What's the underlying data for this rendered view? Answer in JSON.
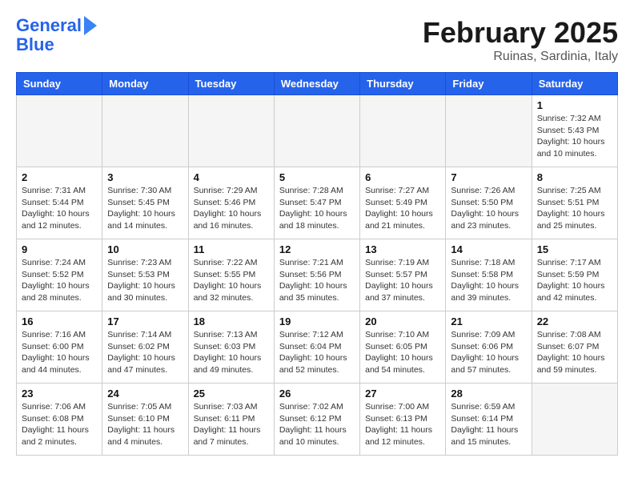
{
  "header": {
    "logo_line1": "General",
    "logo_line2": "Blue",
    "month_title": "February 2025",
    "location": "Ruinas, Sardinia, Italy"
  },
  "days_of_week": [
    "Sunday",
    "Monday",
    "Tuesday",
    "Wednesday",
    "Thursday",
    "Friday",
    "Saturday"
  ],
  "weeks": [
    [
      {
        "day": "",
        "info": ""
      },
      {
        "day": "",
        "info": ""
      },
      {
        "day": "",
        "info": ""
      },
      {
        "day": "",
        "info": ""
      },
      {
        "day": "",
        "info": ""
      },
      {
        "day": "",
        "info": ""
      },
      {
        "day": "1",
        "info": "Sunrise: 7:32 AM\nSunset: 5:43 PM\nDaylight: 10 hours and 10 minutes."
      }
    ],
    [
      {
        "day": "2",
        "info": "Sunrise: 7:31 AM\nSunset: 5:44 PM\nDaylight: 10 hours and 12 minutes."
      },
      {
        "day": "3",
        "info": "Sunrise: 7:30 AM\nSunset: 5:45 PM\nDaylight: 10 hours and 14 minutes."
      },
      {
        "day": "4",
        "info": "Sunrise: 7:29 AM\nSunset: 5:46 PM\nDaylight: 10 hours and 16 minutes."
      },
      {
        "day": "5",
        "info": "Sunrise: 7:28 AM\nSunset: 5:47 PM\nDaylight: 10 hours and 18 minutes."
      },
      {
        "day": "6",
        "info": "Sunrise: 7:27 AM\nSunset: 5:49 PM\nDaylight: 10 hours and 21 minutes."
      },
      {
        "day": "7",
        "info": "Sunrise: 7:26 AM\nSunset: 5:50 PM\nDaylight: 10 hours and 23 minutes."
      },
      {
        "day": "8",
        "info": "Sunrise: 7:25 AM\nSunset: 5:51 PM\nDaylight: 10 hours and 25 minutes."
      }
    ],
    [
      {
        "day": "9",
        "info": "Sunrise: 7:24 AM\nSunset: 5:52 PM\nDaylight: 10 hours and 28 minutes."
      },
      {
        "day": "10",
        "info": "Sunrise: 7:23 AM\nSunset: 5:53 PM\nDaylight: 10 hours and 30 minutes."
      },
      {
        "day": "11",
        "info": "Sunrise: 7:22 AM\nSunset: 5:55 PM\nDaylight: 10 hours and 32 minutes."
      },
      {
        "day": "12",
        "info": "Sunrise: 7:21 AM\nSunset: 5:56 PM\nDaylight: 10 hours and 35 minutes."
      },
      {
        "day": "13",
        "info": "Sunrise: 7:19 AM\nSunset: 5:57 PM\nDaylight: 10 hours and 37 minutes."
      },
      {
        "day": "14",
        "info": "Sunrise: 7:18 AM\nSunset: 5:58 PM\nDaylight: 10 hours and 39 minutes."
      },
      {
        "day": "15",
        "info": "Sunrise: 7:17 AM\nSunset: 5:59 PM\nDaylight: 10 hours and 42 minutes."
      }
    ],
    [
      {
        "day": "16",
        "info": "Sunrise: 7:16 AM\nSunset: 6:00 PM\nDaylight: 10 hours and 44 minutes."
      },
      {
        "day": "17",
        "info": "Sunrise: 7:14 AM\nSunset: 6:02 PM\nDaylight: 10 hours and 47 minutes."
      },
      {
        "day": "18",
        "info": "Sunrise: 7:13 AM\nSunset: 6:03 PM\nDaylight: 10 hours and 49 minutes."
      },
      {
        "day": "19",
        "info": "Sunrise: 7:12 AM\nSunset: 6:04 PM\nDaylight: 10 hours and 52 minutes."
      },
      {
        "day": "20",
        "info": "Sunrise: 7:10 AM\nSunset: 6:05 PM\nDaylight: 10 hours and 54 minutes."
      },
      {
        "day": "21",
        "info": "Sunrise: 7:09 AM\nSunset: 6:06 PM\nDaylight: 10 hours and 57 minutes."
      },
      {
        "day": "22",
        "info": "Sunrise: 7:08 AM\nSunset: 6:07 PM\nDaylight: 10 hours and 59 minutes."
      }
    ],
    [
      {
        "day": "23",
        "info": "Sunrise: 7:06 AM\nSunset: 6:08 PM\nDaylight: 11 hours and 2 minutes."
      },
      {
        "day": "24",
        "info": "Sunrise: 7:05 AM\nSunset: 6:10 PM\nDaylight: 11 hours and 4 minutes."
      },
      {
        "day": "25",
        "info": "Sunrise: 7:03 AM\nSunset: 6:11 PM\nDaylight: 11 hours and 7 minutes."
      },
      {
        "day": "26",
        "info": "Sunrise: 7:02 AM\nSunset: 6:12 PM\nDaylight: 11 hours and 10 minutes."
      },
      {
        "day": "27",
        "info": "Sunrise: 7:00 AM\nSunset: 6:13 PM\nDaylight: 11 hours and 12 minutes."
      },
      {
        "day": "28",
        "info": "Sunrise: 6:59 AM\nSunset: 6:14 PM\nDaylight: 11 hours and 15 minutes."
      },
      {
        "day": "",
        "info": ""
      }
    ]
  ]
}
